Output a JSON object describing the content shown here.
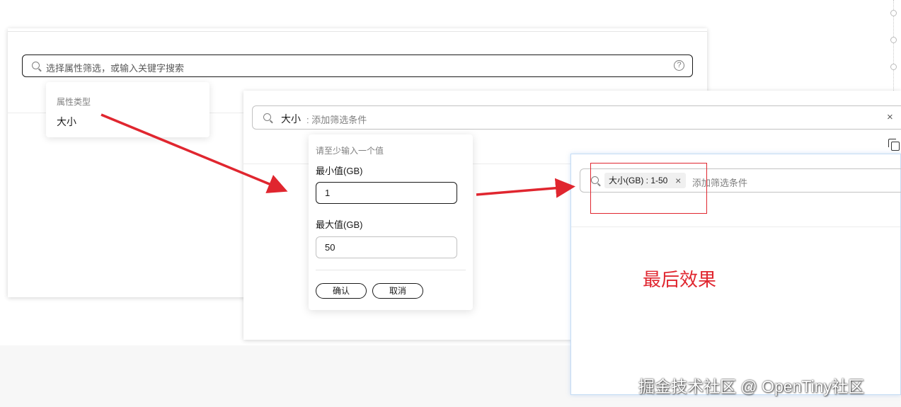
{
  "panel1": {
    "search_placeholder": "选择属性筛选，或输入关键字搜索",
    "help_glyph": "?",
    "dropdown": {
      "header": "属性类型",
      "item": "大小"
    }
  },
  "panel2": {
    "tag_key": "大小",
    "placeholder": ": 添加筛选条件",
    "clear_glyph": "×",
    "range_popover": {
      "hint": "请至少输入一个值",
      "min_label": "最小值(GB)",
      "min_value": "1",
      "max_label": "最大值(GB)",
      "max_value": "50",
      "confirm_label": "确认",
      "cancel_label": "取消"
    }
  },
  "panel3": {
    "chip_label": "大小(GB) : 1-50",
    "chip_close_glyph": "×",
    "placeholder": "添加筛选条件"
  },
  "annotation": {
    "result_label": "最后效果",
    "color": "#e0262f"
  },
  "watermark": "掘金技术社区 @ OpenTiny社区"
}
